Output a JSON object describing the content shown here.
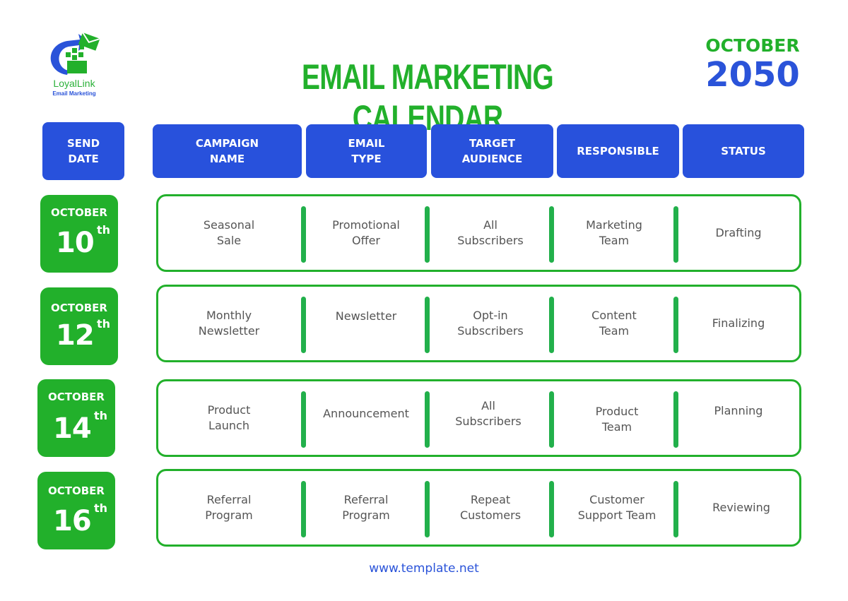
{
  "logo": {
    "name": "LoyalLink",
    "tagline": "Email Marketing",
    "icon": "email-arrow-icon"
  },
  "header": {
    "title": "EMAIL MARKETING CALENDAR",
    "month": "OCTOBER",
    "year": "2050"
  },
  "colors": {
    "green": "#22b02b",
    "blue": "#2851dc",
    "text_gray": "#555555"
  },
  "columns": [
    {
      "label": "SEND\nDATE"
    },
    {
      "label": "CAMPAIGN\nNAME"
    },
    {
      "label": "EMAIL\nTYPE"
    },
    {
      "label": "TARGET\nAUDIENCE"
    },
    {
      "label": "RESPONSIBLE"
    },
    {
      "label": "STATUS"
    }
  ],
  "rows": [
    {
      "month": "OCTOBER",
      "day": "10",
      "suffix": "th",
      "campaign": "Seasonal\nSale",
      "email_type": "Promotional\nOffer",
      "audience": "All\nSubscribers",
      "responsible": "Marketing\nTeam",
      "status": "Drafting"
    },
    {
      "month": "OCTOBER",
      "day": "12",
      "suffix": "th",
      "campaign": "Monthly\nNewsletter",
      "email_type": "Newsletter",
      "audience": "Opt-in\nSubscribers",
      "responsible": "Content\nTeam",
      "status": "Finalizing"
    },
    {
      "month": "OCTOBER",
      "day": "14",
      "suffix": "th",
      "campaign": "Product\nLaunch",
      "email_type": "Announcement",
      "audience": "All\nSubscribers",
      "responsible": "Product\nTeam",
      "status": "Planning"
    },
    {
      "month": "OCTOBER",
      "day": "16",
      "suffix": "th",
      "campaign": "Referral\nProgram",
      "email_type": "Referral\nProgram",
      "audience": "Repeat\nCustomers",
      "responsible": "Customer\nSupport Team",
      "status": "Reviewing"
    }
  ],
  "footer": {
    "url": "www.template.net"
  }
}
